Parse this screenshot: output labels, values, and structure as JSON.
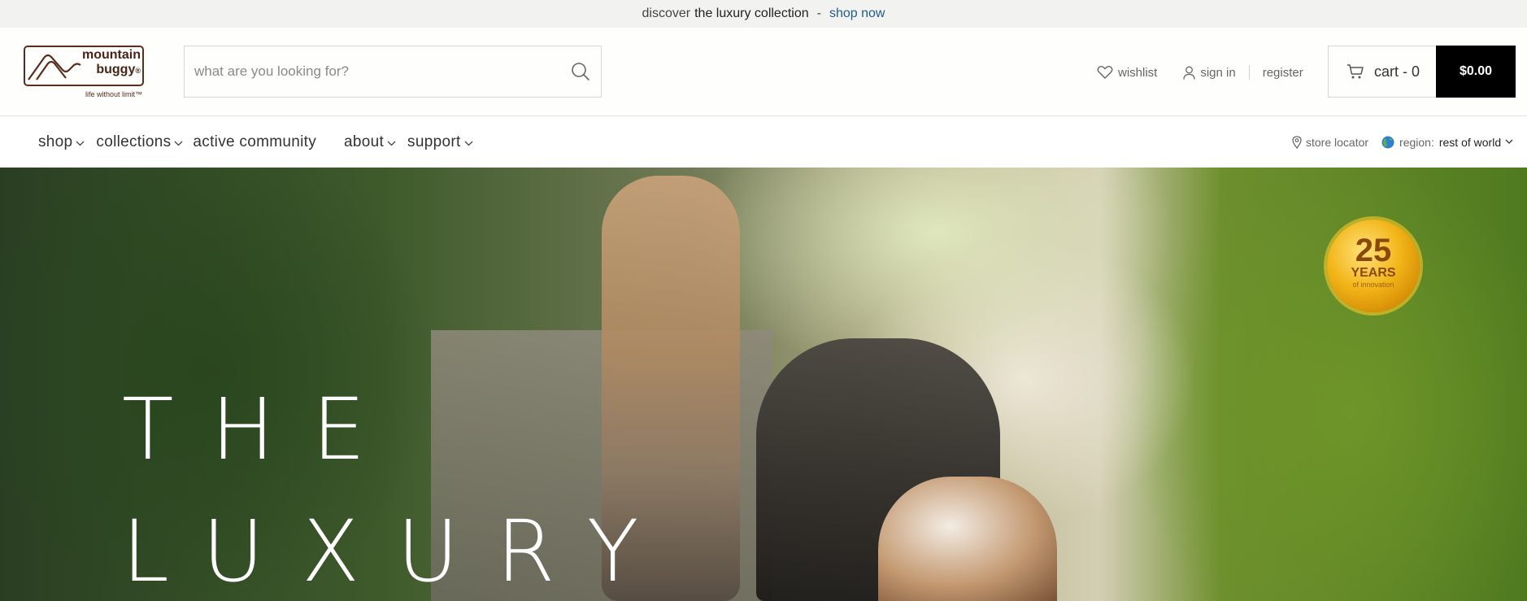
{
  "announcement": {
    "prefix": "discover",
    "highlight": "the luxury collection",
    "separator": "-",
    "link": "shop now"
  },
  "logo": {
    "line1": "mountain",
    "line2": "buggy",
    "registered": "®",
    "tagline": "life without limit™"
  },
  "search": {
    "placeholder": "what are you looking for?",
    "value": ""
  },
  "account": {
    "wishlist": "wishlist",
    "sign_in": "sign in",
    "register": "register"
  },
  "cart": {
    "label": "cart - 0",
    "total": "$0.00"
  },
  "nav": {
    "items": [
      {
        "label": "shop",
        "dropdown": true
      },
      {
        "label": "collections",
        "dropdown": true
      },
      {
        "label": "active community",
        "dropdown": false
      },
      {
        "label": "about",
        "dropdown": true
      },
      {
        "label": "support",
        "dropdown": true
      }
    ],
    "store_locator": "store locator",
    "region_label": "region:",
    "region_value": "rest of world"
  },
  "hero": {
    "line1": "THE",
    "line2": "LUXURY",
    "badge": {
      "number": "25",
      "years": "YEARS",
      "sub": "of innovation"
    }
  },
  "colors": {
    "announcement_bg": "#f2f3f1",
    "link": "#1f5a8f",
    "brand_brown": "#4a2517",
    "cart_total_bg": "#000000",
    "badge_gold": "#f2b518"
  },
  "icons": [
    "search-icon",
    "heart-icon",
    "user-icon",
    "cart-icon",
    "chevron-down-icon",
    "map-pin-icon",
    "globe-icon"
  ]
}
